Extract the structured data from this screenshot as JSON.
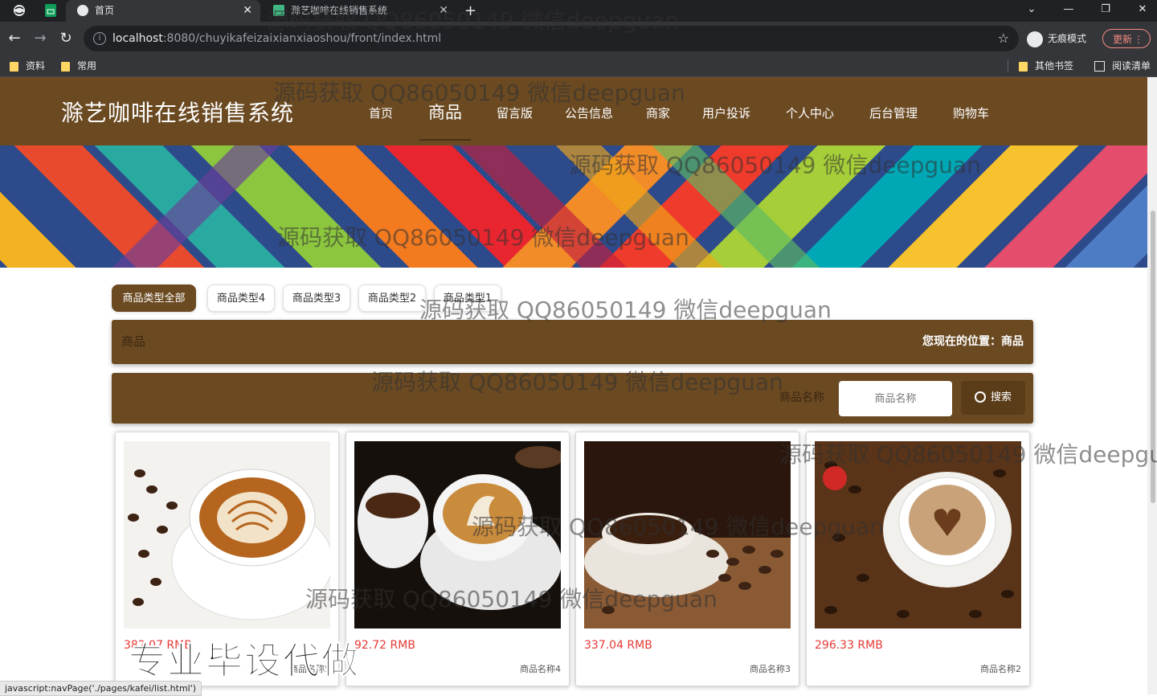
{
  "browser": {
    "tabs": [
      {
        "label": "首页",
        "close": "✕"
      },
      {
        "label": "滁艺咖啡在线销售系统",
        "close": "✕"
      }
    ],
    "new_tab": "+",
    "window_controls": {
      "minimize": "—",
      "restore": "❐",
      "close": "✕"
    },
    "url_host": "localhost",
    "url_rest": ":8080/chuyikafeizaixianxiaoshou/front/index.html",
    "incognito": "无痕模式",
    "update": "更新",
    "bookmarks": [
      "资料",
      "常用"
    ],
    "bookmarks_right": [
      "其他书签",
      "阅读清单"
    ]
  },
  "site": {
    "title": "滁艺咖啡在线销售系统",
    "nav": [
      "首页",
      "商品",
      "留言版",
      "公告信息",
      "商家",
      "用户投诉",
      "个人中心",
      "后台管理",
      "购物车"
    ],
    "active_nav": "商品"
  },
  "categories": [
    "商品类型全部",
    "商品类型4",
    "商品类型3",
    "商品类型2",
    "商品类型1"
  ],
  "breadcrumb": {
    "left": "商品",
    "right": "您现在的位置：商品"
  },
  "search": {
    "label": "商品名称",
    "placeholder": "商品名称",
    "button": "搜索"
  },
  "products": [
    {
      "price": "382.07 RMB",
      "name": "商品名称5"
    },
    {
      "price": "92.72 RMB",
      "name": "商品名称4"
    },
    {
      "price": "337.04 RMB",
      "name": "商品名称3"
    },
    {
      "price": "296.33 RMB",
      "name": "商品名称2"
    }
  ],
  "watermark": "源码获取 QQ86050149 微信deepguan",
  "overlay_text": "专业毕设代做",
  "status_url": "javascript:navPage('./pages/kafei/list.html')",
  "colors": {
    "header": "#6b4a22",
    "price": "#e53935"
  }
}
